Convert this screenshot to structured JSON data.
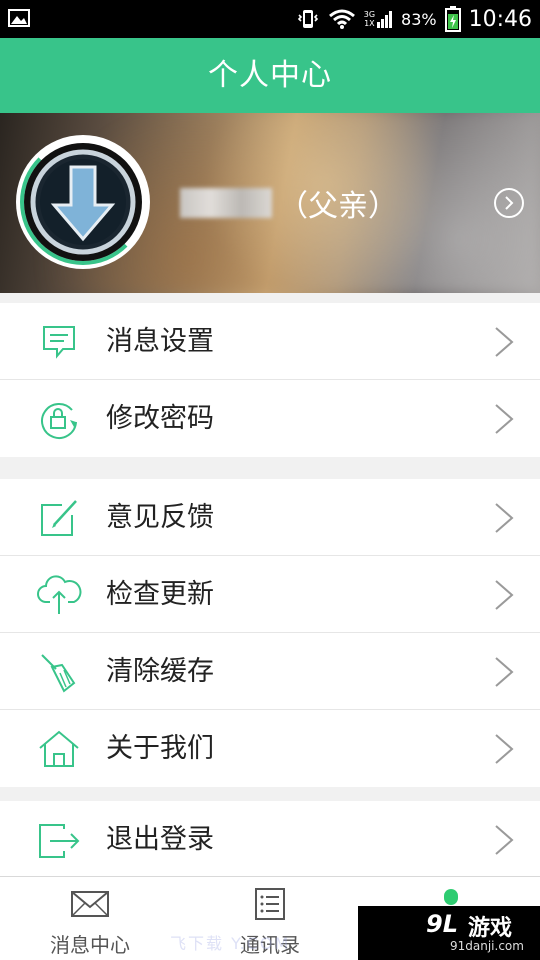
{
  "status_bar": {
    "battery": "83%",
    "time": "10:46",
    "network_top": "3G",
    "network_bottom": "1X"
  },
  "header": {
    "title": "个人中心"
  },
  "profile": {
    "role": "（父亲）"
  },
  "menu_groups": [
    [
      {
        "label": "消息设置",
        "icon": "message-settings-icon"
      },
      {
        "label": "修改密码",
        "icon": "lock-refresh-icon"
      }
    ],
    [
      {
        "label": "意见反馈",
        "icon": "feedback-edit-icon"
      },
      {
        "label": "检查更新",
        "icon": "cloud-upload-icon"
      },
      {
        "label": "清除缓存",
        "icon": "broom-icon"
      },
      {
        "label": "关于我们",
        "icon": "home-icon"
      }
    ],
    [
      {
        "label": "退出登录",
        "icon": "logout-icon"
      }
    ]
  ],
  "tabbar": {
    "tabs": [
      {
        "label": "消息中心",
        "icon": "mail-icon"
      },
      {
        "label": "通讯录",
        "icon": "contacts-list-icon"
      },
      {
        "label": "",
        "icon": "profile-tab-icon"
      }
    ]
  },
  "watermark": {
    "ghost_text": "飞下载  Y.COM",
    "brand_logo": "9L",
    "brand_name": "游戏",
    "brand_site": "91danji.com"
  },
  "colors": {
    "accent": "#38c48a",
    "icon_stroke": "#38c48a",
    "text": "#222222"
  }
}
